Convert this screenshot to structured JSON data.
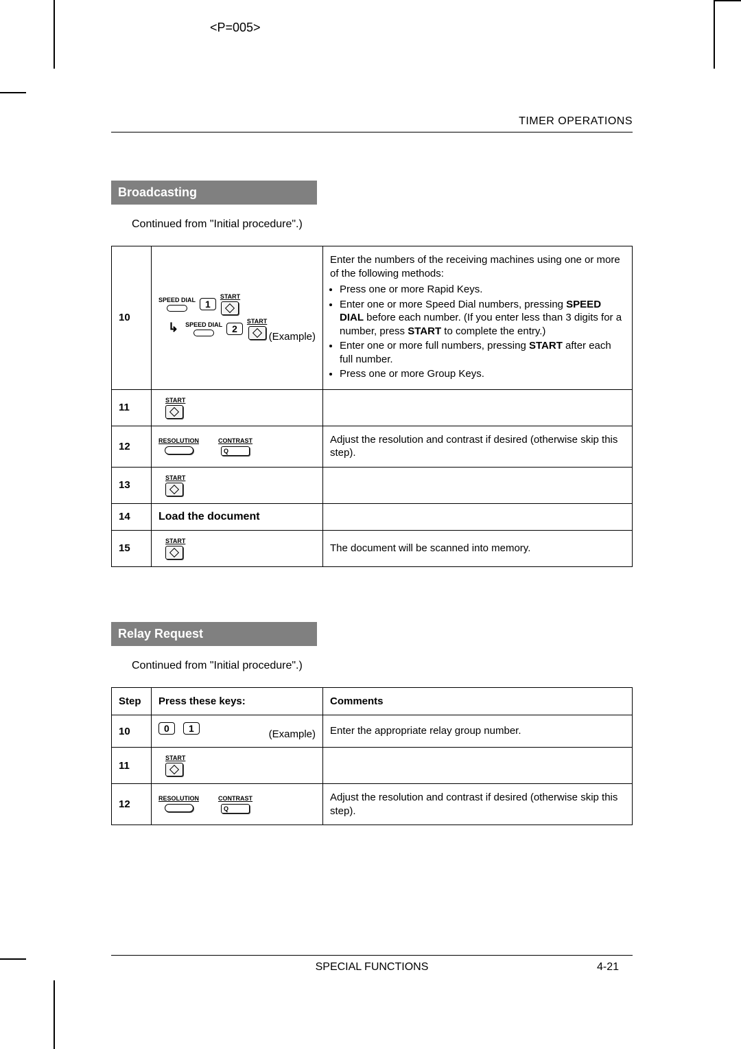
{
  "page_code": "<P=005>",
  "header_right": "TIMER OPERATIONS",
  "section1": {
    "title": "Broadcasting",
    "continued": "Continued from \"Initial procedure\".)",
    "rows": [
      {
        "step": "10",
        "keys_extra": "(Example)",
        "sd_label": "SPEED DIAL",
        "start_label": "START",
        "num1": "1",
        "num2": "2",
        "comment_intro": "Enter the numbers of the receiving machines using one or more of the following methods:",
        "b1": "Press one or more Rapid Keys.",
        "b2a": "Enter one or more Speed Dial numbers, pressing ",
        "b2b": "SPEED DIAL",
        "b2c": " before each number. (If you enter less than 3 digits for a number, press ",
        "b2d": "START",
        "b2e": " to complete the entry.)",
        "b3a": "Enter one or more full numbers, pressing ",
        "b3b": "START",
        "b3c": " after each full number.",
        "b4": "Press one or more Group Keys."
      },
      {
        "step": "11",
        "start_label": "START"
      },
      {
        "step": "12",
        "res_label": "RESOLUTION",
        "con_label": "CONTRAST",
        "comment": "Adjust the resolution and contrast if desired (otherwise skip this step)."
      },
      {
        "step": "13",
        "start_label": "START"
      },
      {
        "step": "14",
        "keys_text": "Load the document"
      },
      {
        "step": "15",
        "start_label": "START",
        "comment": "The document will be scanned into memory."
      }
    ]
  },
  "section2": {
    "title": "Relay Request",
    "continued": "Continued from \"Initial procedure\".)",
    "header_step": "Step",
    "header_keys": "Press these keys:",
    "header_comm": "Comments",
    "rows": [
      {
        "step": "10",
        "num1": "0",
        "num2": "1",
        "keys_extra": "(Example)",
        "comment": "Enter the appropriate relay group number."
      },
      {
        "step": "11",
        "start_label": "START"
      },
      {
        "step": "12",
        "res_label": "RESOLUTION",
        "con_label": "CONTRAST",
        "comment": "Adjust the resolution and contrast if desired (otherwise skip this step)."
      }
    ]
  },
  "footer_center": "SPECIAL FUNCTIONS",
  "footer_pnum": "4-21",
  "q_label": "Q"
}
